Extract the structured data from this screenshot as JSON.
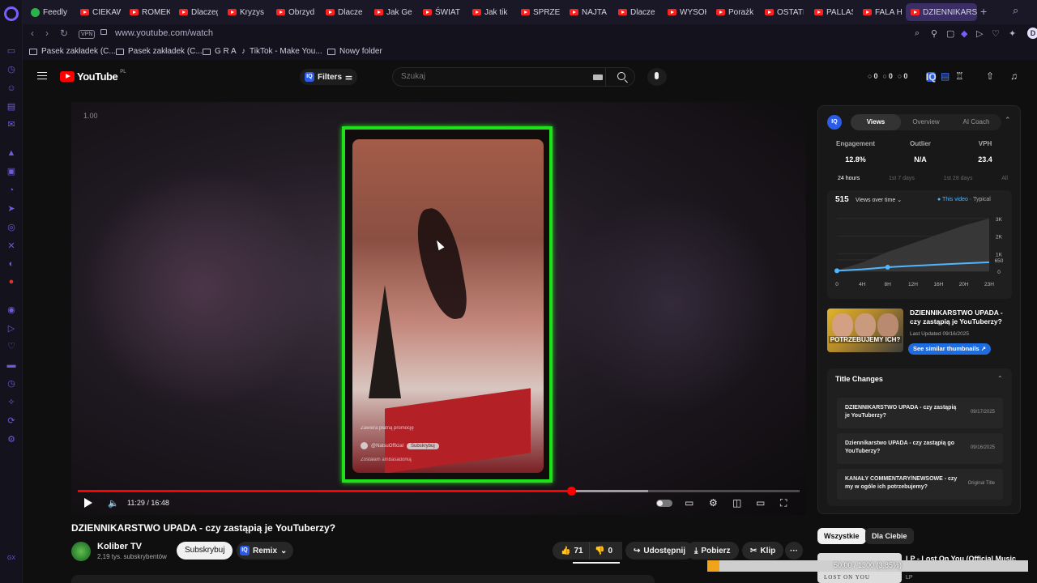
{
  "browser": {
    "tabs": [
      "Feedly",
      "CIEKAW",
      "ROMEK",
      "Dlaczeg",
      "Kryzys",
      "Obrzyd",
      "Dlacze",
      "Jak Ge",
      "ŚWIAT",
      "Jak tik",
      "SPRZEE",
      "NAJTA",
      "Dlacze",
      "WYSOK",
      "Porażk",
      "OSTATI",
      "PALLAS",
      "FALA H",
      "DZIENNIKARST"
    ],
    "url": "www.youtube.com/watch",
    "vpn_label": "VPN",
    "profile_initial": "D",
    "bookmarks": [
      "Pasek zakładek (C...",
      "Pasek zakładek (C...",
      "G R A",
      "TikTok - Make You...",
      "Nowy folder"
    ]
  },
  "youtube": {
    "logo_text": "YouTube",
    "region": "PL",
    "filters_label": "Filters",
    "search_placeholder": "Szukaj",
    "header_stats": [
      "0",
      "0",
      "0"
    ]
  },
  "player": {
    "speed": "1.00",
    "current_time": "11:29",
    "duration": "16:48",
    "time_display": "11:29 / 16:48",
    "progress_played_fraction": 0.684,
    "progress_loaded_fraction": 0.79,
    "overlay": {
      "promo": "Zawiera płatną promocję",
      "handle": "@NatsuOfficial",
      "subscribe": "Subskrybuj",
      "caption": "Zostałam ambasadorką"
    }
  },
  "video": {
    "title": "DZIENNIKARSTWO UPADA - czy zastąpią je YouTuberzy?",
    "channel": "Koliber TV",
    "subscribers": "2,19 tys. subskrybentów",
    "subscribe_label": "Subskrybuj",
    "remix_label": "Remix",
    "likes": "71",
    "dislikes": "0",
    "share_label": "Udostępnij",
    "download_label": "Pobierz",
    "clip_label": "Klip",
    "more_label": "···"
  },
  "iq_panel": {
    "logo": "IQ",
    "tabs": [
      "Views",
      "Overview",
      "AI Coach"
    ],
    "active_tab": "Views",
    "metrics": [
      {
        "label": "Engagement",
        "value": "12.8%"
      },
      {
        "label": "Outlier",
        "value": "N/A"
      },
      {
        "label": "VPH",
        "value": "23.4"
      }
    ],
    "ranges": [
      "24 hours",
      "1st 7 days",
      "1st 28 days",
      "All"
    ],
    "active_range": "24 hours",
    "views": "515",
    "views_label": "Views over time",
    "legend_this": "This video",
    "legend_typical": "Typical",
    "related": {
      "thumb_caption": "POTRZEBUJEMY ICH?",
      "title": "DZIENNIKARSTWO UPADA - czy zastąpią je YouTuberzy?",
      "updated": "Last Updated 09/16/2025",
      "similar_button": "See similar thumbnails"
    },
    "title_changes_heading": "Title Changes",
    "title_changes": [
      {
        "title": "DZIENNIKARSTWO UPADA - czy zastąpią je YouTuberzy?",
        "date": "09/17/2025"
      },
      {
        "title": "Dziennikarstwo UPADA - czy zastąpią go YouTuberzy?",
        "date": "09/16/2025"
      },
      {
        "title": "KANAŁY COMMENTARY/NEWSOWE - czy my w ogóle ich potrzebujemy?",
        "date": "Original Title"
      }
    ]
  },
  "chart_data": {
    "type": "area",
    "title": "",
    "x": [
      "0",
      "4H",
      "8H",
      "12H",
      "16H",
      "20H",
      "23H"
    ],
    "yticks": [
      "3K",
      "2K",
      "1K",
      "650",
      "0"
    ],
    "ylim": [
      0,
      3500
    ],
    "series": [
      {
        "name": "This video",
        "values": [
          30,
          110,
          230,
          310,
          380,
          450,
          515
        ]
      },
      {
        "name": "Typical",
        "values": [
          60,
          500,
          1100,
          1600,
          2100,
          2600,
          3000
        ]
      }
    ],
    "grid": true
  },
  "below": {
    "chips": [
      "Wszystkie",
      "Dla Ciebie"
    ],
    "next_video_title": "LP - Lost On You (Official Music",
    "next_video_channel": "LP",
    "next_video_thumb_text": "LOST ON YOU"
  },
  "download": {
    "text": "50,00 / 1300 (3,85%)",
    "fraction": 0.0385
  }
}
